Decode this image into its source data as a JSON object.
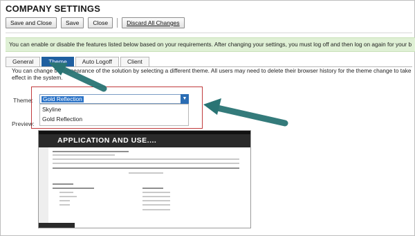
{
  "page": {
    "title": "COMPANY SETTINGS"
  },
  "toolbar": {
    "save_close": "Save and Close",
    "save": "Save",
    "close": "Close",
    "discard": "Discard All Changes"
  },
  "info_text": "You can enable or disable the features listed below based on your requirements. After changing your settings, you must log off and then log on again for your b",
  "tabs": [
    {
      "label": "General"
    },
    {
      "label": "Theme",
      "active": true
    },
    {
      "label": "Auto Logoff"
    },
    {
      "label": "Client"
    }
  ],
  "description": "You can change the appearance of the solution by selecting a different theme. All users may need to delete their browser history for the theme change to take effect in the system.",
  "theme": {
    "label": "Theme:",
    "selected": "Gold Reflection",
    "options": [
      "Skyline",
      "Gold Reflection"
    ]
  },
  "preview": {
    "label": "Preview:",
    "title": "APPLICATION AND USE...."
  },
  "colors": {
    "active_tab": "#1f5fa0",
    "info_bg": "#dff0d5",
    "highlight": "#c0393b",
    "annotation_arrow": "#1f6b6b"
  }
}
